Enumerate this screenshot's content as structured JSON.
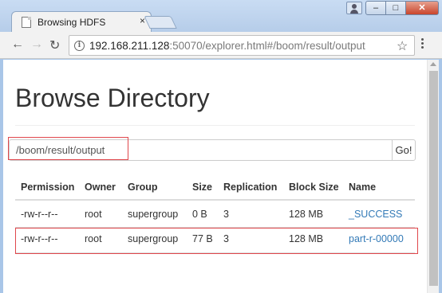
{
  "browser": {
    "tab_title": "Browsing HDFS",
    "tab_close": "×",
    "url_host": "192.168.211.128",
    "url_rest": ":50070/explorer.html#/boom/result/output",
    "window_buttons": {
      "minimize": "–",
      "maximize": "□",
      "close": "✕"
    },
    "nav": {
      "back": "←",
      "forward": "→",
      "reload": "↻"
    },
    "star": "☆",
    "info": "i"
  },
  "page": {
    "title": "Browse Directory",
    "path_value": "/boom/result/output",
    "go_label": "Go!"
  },
  "table": {
    "headers": [
      "Permission",
      "Owner",
      "Group",
      "Size",
      "Replication",
      "Block Size",
      "Name"
    ],
    "rows": [
      [
        "-rw-r--r--",
        "root",
        "supergroup",
        "0 B",
        "3",
        "128 MB",
        "_SUCCESS"
      ],
      [
        "-rw-r--r--",
        "root",
        "supergroup",
        "77 B",
        "3",
        "128 MB",
        "part-r-00000"
      ]
    ]
  },
  "colors": {
    "link": "#337ab7",
    "highlight": "#e0474c",
    "url_bar_bg": "#f2f2f2"
  }
}
